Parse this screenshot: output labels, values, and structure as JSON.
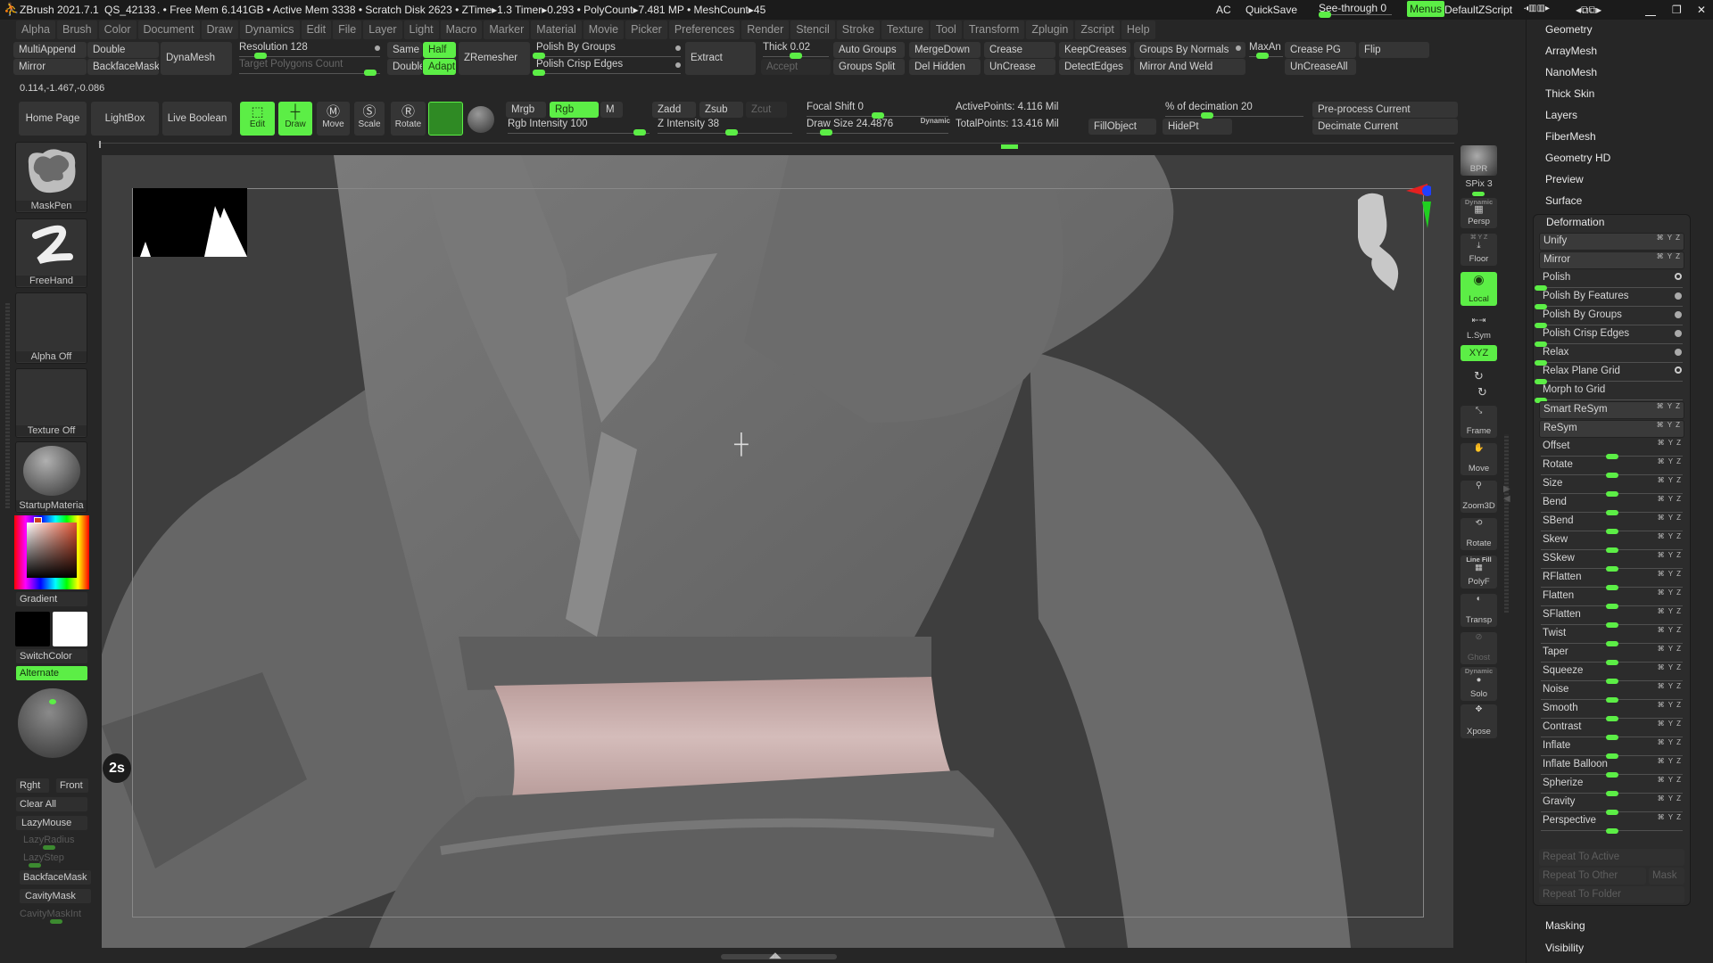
{
  "title_bar": {
    "app": "ZBrush 2021.7.1",
    "file": "QS_42133",
    "stats": ". • Free Mem 6.141GB • Active Mem 3338 • Scratch Disk 2623 • ZTime▸1.3 Timer▸0.293 • PolyCount▸7.481 MP • MeshCount▸45",
    "ac": "AC",
    "quicksave": "QuickSave",
    "see_through": "See-through  0",
    "menus": "Menus",
    "script": "DefaultZScript"
  },
  "menu": [
    "Alpha",
    "Brush",
    "Color",
    "Document",
    "Draw",
    "Dynamics",
    "Edit",
    "File",
    "Layer",
    "Light",
    "Macro",
    "Marker",
    "Material",
    "Movie",
    "Picker",
    "Preferences",
    "Render",
    "Stencil",
    "Stroke",
    "Texture",
    "Tool",
    "Transform",
    "Zplugin",
    "Zscript",
    "Help"
  ],
  "geometry_bar": {
    "multiappend": "MultiAppend",
    "mirror": "Mirror",
    "double": "Double",
    "backfacemask": "BackfaceMask",
    "dynamesh": "DynaMesh",
    "resolution": "Resolution 128",
    "target_polygons": "Target Polygons Count",
    "same": "Same",
    "double2": "Double",
    "half": "Half",
    "adapt": "Adapt",
    "zremesher": "ZRemesher",
    "polish_by_groups": "Polish By Groups",
    "polish_crisp_edges": "Polish Crisp Edges",
    "extract": "Extract",
    "thick": "Thick 0.02",
    "accept": "Accept",
    "auto_groups": "Auto Groups",
    "groups_split": "Groups Split",
    "mergedown": "MergeDown",
    "del_hidden": "Del Hidden",
    "crease": "Crease",
    "uncrease": "UnCrease",
    "keepcreases": "KeepCreases",
    "detectedges": "DetectEdges",
    "groups_by_normals": "Groups By Normals",
    "mirror_and_weld": "Mirror And Weld",
    "maxan": "MaxAn",
    "crease_pg": "Crease PG",
    "uncreaseall": "UnCreaseAll",
    "flip": "Flip"
  },
  "coordinates": "0.114,-1.467,-0.086",
  "draw_bar": {
    "home_page": "Home Page",
    "lightbox": "LightBox",
    "live_boolean": "Live Boolean",
    "edit": "Edit",
    "draw": "Draw",
    "move": "Move",
    "scale": "Scale",
    "rotate": "Rotate",
    "mrgb": "Mrgb",
    "rgb": "Rgb",
    "m": "M",
    "rgb_intensity": "Rgb Intensity 100",
    "zadd": "Zadd",
    "zsub": "Zsub",
    "zcut": "Zcut",
    "z_intensity": "Z Intensity 38",
    "focal_shift": "Focal Shift 0",
    "draw_size": "Draw Size 24.4876",
    "dynamic": "Dynamic",
    "active_points": "ActivePoints: 4.116 Mil",
    "total_points": "TotalPoints: 13.416 Mil",
    "fillobject": "FillObject",
    "hidept": "HidePt",
    "decimation": "% of decimation 20",
    "preprocess": "Pre-process Current",
    "decimate": "Decimate Current"
  },
  "left_shelf": {
    "brush": "MaskPen",
    "stroke": "FreeHand",
    "alpha": "Alpha Off",
    "texture": "Texture Off",
    "material": "StartupMateria",
    "gradient": "Gradient",
    "switchcolor": "SwitchColor",
    "alternate": "Alternate",
    "rght": "Rght",
    "front": "Front",
    "clear_all": "Clear All",
    "lazymouse": "LazyMouse",
    "lazyradius": "LazyRadius",
    "lazystep": "LazyStep",
    "backfacemask": "BackfaceMask",
    "cavitymask": "CavityMask",
    "cavitymaskint": "CavityMaskInt"
  },
  "viewport": {
    "timer_badge": "2s"
  },
  "right_tray": {
    "bpr": "BPR",
    "spix": "SPix 3",
    "dynamic": "Dynamic",
    "persp": "Persp",
    "floor": "Floor",
    "local": "Local",
    "lsym": "L.Sym",
    "xyz": "XYZ",
    "frame": "Frame",
    "move": "Move",
    "zoom3d": "Zoom3D",
    "rotate": "Rotate",
    "line_fill": "Line Fill",
    "polyf": "PolyF",
    "transp": "Transp",
    "ghost": "Ghost",
    "dynamic2": "Dynamic",
    "solo": "Solo",
    "xpose": "Xpose"
  },
  "tool_palette": {
    "sections_top": [
      "Geometry",
      "ArrayMesh",
      "NanoMesh",
      "Thick Skin",
      "Layers",
      "FiberMesh",
      "Geometry HD",
      "Preview",
      "Surface"
    ],
    "deformation": {
      "title": "Deformation",
      "items": [
        {
          "label": "Unify",
          "type": "button"
        },
        {
          "label": "Mirror",
          "type": "button"
        },
        {
          "label": "Polish",
          "type": "slider",
          "value": 0,
          "indicator": "ring"
        },
        {
          "label": "Polish By Features",
          "type": "slider",
          "value": 0,
          "indicator": "dot"
        },
        {
          "label": "Polish By Groups",
          "type": "slider",
          "value": 0,
          "indicator": "dot"
        },
        {
          "label": "Polish Crisp Edges",
          "type": "slider",
          "value": 0,
          "indicator": "dot"
        },
        {
          "label": "Relax",
          "type": "slider",
          "value": 0,
          "indicator": "dot"
        },
        {
          "label": "Relax Plane Grid",
          "type": "slider",
          "value": 0,
          "indicator": "ring"
        },
        {
          "label": "Morph to Grid",
          "type": "slider",
          "value": 0
        },
        {
          "label": "Smart ReSym",
          "type": "button"
        },
        {
          "label": "ReSym",
          "type": "button"
        },
        {
          "label": "Offset",
          "type": "bipolar",
          "value": 0
        },
        {
          "label": "Rotate",
          "type": "bipolar",
          "value": 0
        },
        {
          "label": "Size",
          "type": "bipolar",
          "value": 0
        },
        {
          "label": "Bend",
          "type": "bipolar",
          "value": 0
        },
        {
          "label": "SBend",
          "type": "bipolar",
          "value": 0
        },
        {
          "label": "Skew",
          "type": "bipolar",
          "value": 0
        },
        {
          "label": "SSkew",
          "type": "bipolar",
          "value": 0
        },
        {
          "label": "RFlatten",
          "type": "bipolar",
          "value": 0
        },
        {
          "label": "Flatten",
          "type": "bipolar",
          "value": 0
        },
        {
          "label": "SFlatten",
          "type": "bipolar",
          "value": 0
        },
        {
          "label": "Twist",
          "type": "bipolar",
          "value": 0
        },
        {
          "label": "Taper",
          "type": "bipolar",
          "value": 0
        },
        {
          "label": "Squeeze",
          "type": "bipolar",
          "value": 0
        },
        {
          "label": "Noise",
          "type": "bipolar",
          "value": 0
        },
        {
          "label": "Smooth",
          "type": "bipolar",
          "value": 0
        },
        {
          "label": "Contrast",
          "type": "bipolar",
          "value": 0
        },
        {
          "label": "Inflate",
          "type": "bipolar",
          "value": 0
        },
        {
          "label": "Inflate Balloon",
          "type": "bipolar",
          "value": 0
        },
        {
          "label": "Spherize",
          "type": "bipolar",
          "value": 0
        },
        {
          "label": "Gravity",
          "type": "bipolar",
          "value": 0
        },
        {
          "label": "Perspective",
          "type": "bipolar",
          "value": 0
        }
      ],
      "repeat_to_active": "Repeat To Active",
      "repeat_to_other": "Repeat To Other",
      "mask": "Mask",
      "repeat_to_folder": "Repeat To Folder"
    },
    "sections_bottom": [
      "Masking",
      "Visibility"
    ]
  },
  "colors": {
    "accent": "#5cee46",
    "background": "#262626",
    "button": "#353535",
    "skin": "#c9aeac",
    "mesh": "#6f6f6f"
  }
}
